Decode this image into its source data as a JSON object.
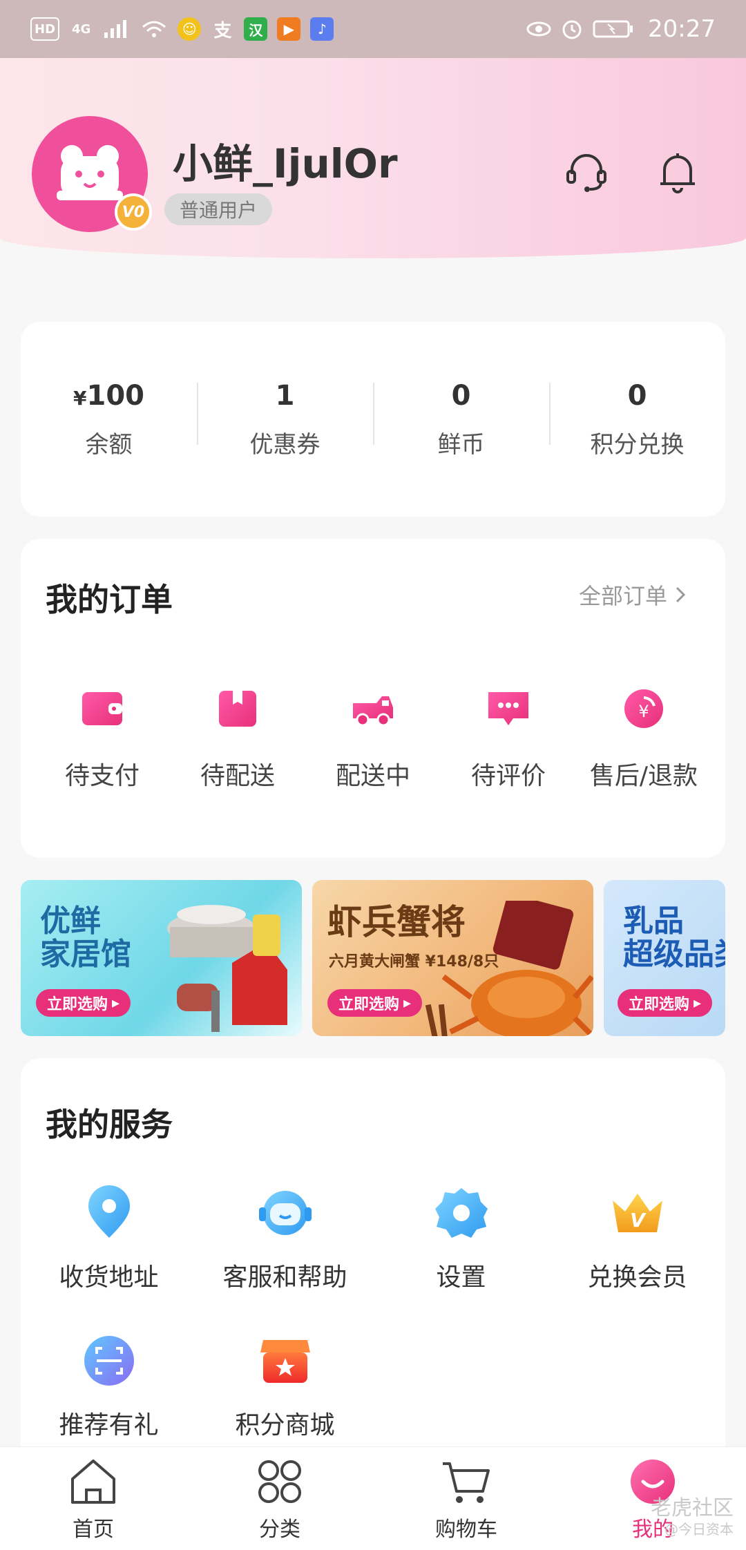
{
  "status_bar": {
    "network": "4G",
    "hd": "HD",
    "time": "20:27"
  },
  "profile": {
    "username": "小鲜_IjulOr",
    "level": "普通用户",
    "badge": "V0"
  },
  "stats": [
    {
      "prefix": "¥",
      "value": "100",
      "label": "余额"
    },
    {
      "prefix": "",
      "value": "1",
      "label": "优惠券"
    },
    {
      "prefix": "",
      "value": "0",
      "label": "鲜币"
    },
    {
      "prefix": "",
      "value": "0",
      "label": "积分兑换"
    }
  ],
  "orders": {
    "title": "我的订单",
    "all_link": "全部订单",
    "items": [
      {
        "label": "待支付",
        "icon": "wallet-icon"
      },
      {
        "label": "待配送",
        "icon": "package-icon"
      },
      {
        "label": "配送中",
        "icon": "delivery-truck-icon"
      },
      {
        "label": "待评价",
        "icon": "comment-icon"
      },
      {
        "label": "售后/退款",
        "icon": "refund-icon"
      }
    ]
  },
  "banners": [
    {
      "title_line1": "优鲜",
      "title_line2": "家居馆",
      "button": "立即选购"
    },
    {
      "title": "虾兵蟹将",
      "subtitle": "六月黄大闸蟹 ¥148/8只",
      "button": "立即选购"
    },
    {
      "title_line1": "乳品",
      "title_line2": "超级品类",
      "button": "立即选购"
    }
  ],
  "services": {
    "title": "我的服务",
    "items": [
      {
        "label": "收货地址",
        "icon": "location-pin-icon"
      },
      {
        "label": "客服和帮助",
        "icon": "customer-service-icon"
      },
      {
        "label": "设置",
        "icon": "settings-gear-icon"
      },
      {
        "label": "兑换会员",
        "icon": "vip-crown-icon"
      },
      {
        "label": "推荐有礼",
        "icon": "scan-icon"
      },
      {
        "label": "积分商城",
        "icon": "store-icon"
      }
    ]
  },
  "tabs": [
    {
      "label": "首页",
      "icon": "home-icon"
    },
    {
      "label": "分类",
      "icon": "category-grid-icon"
    },
    {
      "label": "购物车",
      "icon": "cart-icon"
    },
    {
      "label": "我的",
      "icon": "profile-icon"
    }
  ],
  "watermark": {
    "line1": "老虎社区",
    "line2": "@今日资本"
  },
  "colors": {
    "brand": "#e8307a",
    "avatar": "#f0509b"
  }
}
